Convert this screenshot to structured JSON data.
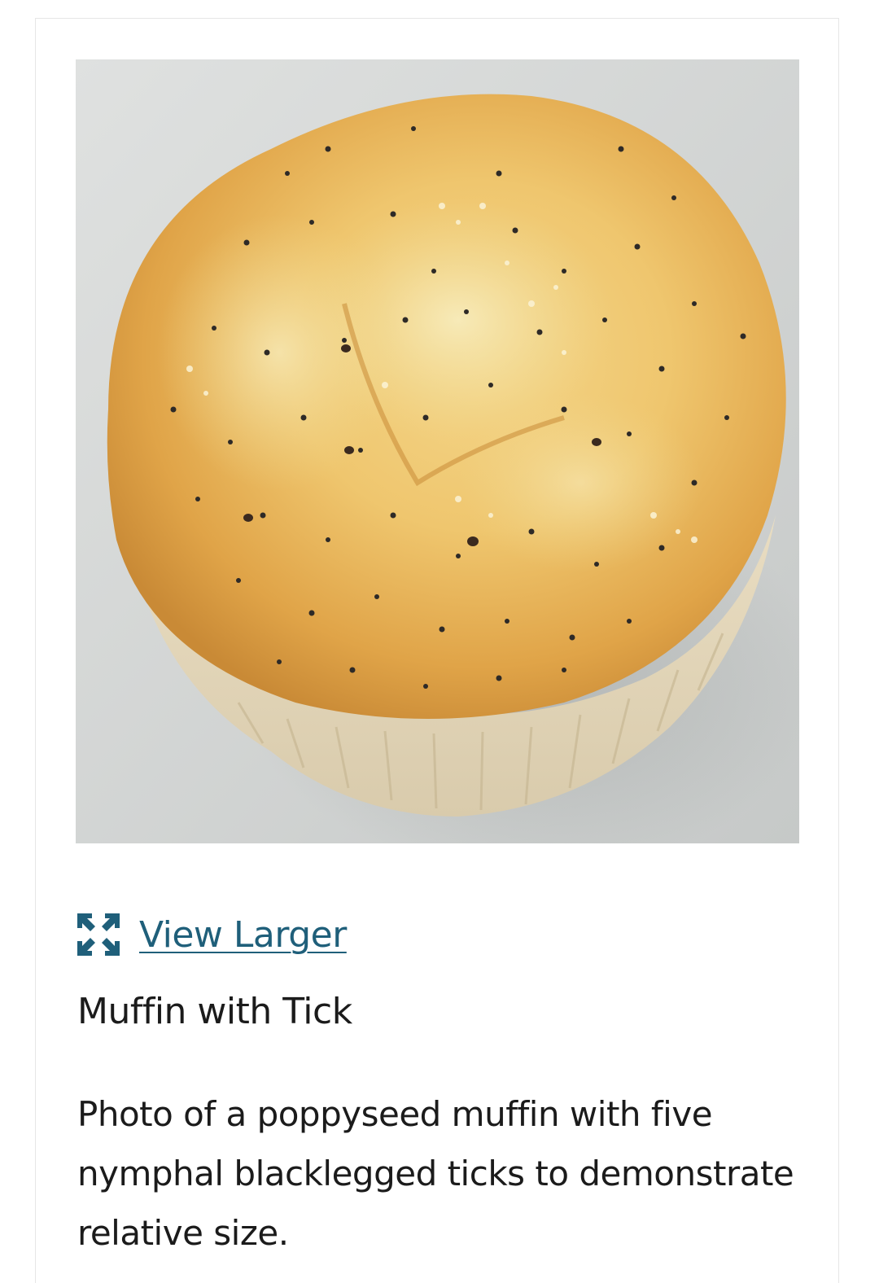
{
  "figure": {
    "image_alt": "Photo of a poppyseed muffin with five nymphal blacklegged ticks to demonstrate relative size.",
    "view_larger_label": "View Larger",
    "view_larger_icon": "expand-arrows-icon",
    "title": "Muffin with Tick",
    "caption": "Photo of a poppyseed muffin with five nymphal blacklegged ticks to demonstrate relative size."
  },
  "colors": {
    "link": "#1f5f7a",
    "icon": "#1f5f7a",
    "text": "#1b1b1b",
    "card_border": "#e6e6e6"
  }
}
